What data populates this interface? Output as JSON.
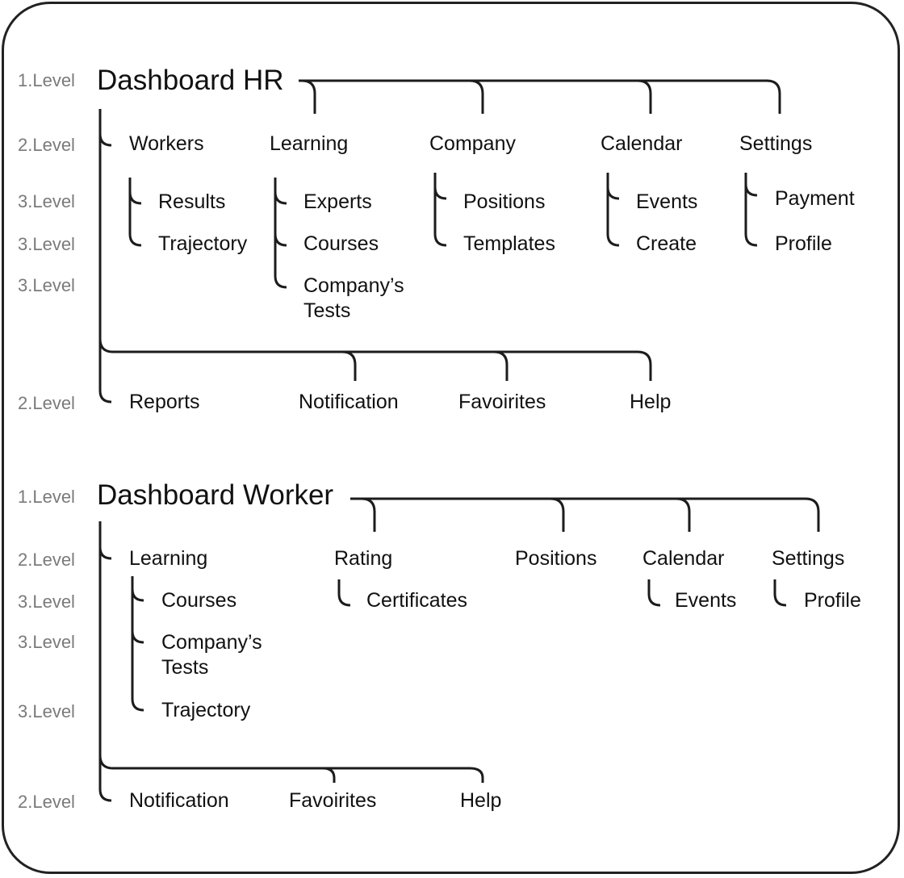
{
  "colors": {
    "line": "#1c1c1c",
    "text": "#111111",
    "level_label": "#7a7a7a",
    "frame": "#222222"
  },
  "hr": {
    "level_labels": [
      "1.Level",
      "2.Level",
      "3.Level",
      "3.Level",
      "3.Level",
      "2.Level"
    ],
    "title": "Dashboard HR",
    "sections": [
      {
        "label": "Workers",
        "children": [
          "Results",
          "Trajectory"
        ]
      },
      {
        "label": "Learning",
        "children": [
          "Experts",
          "Courses",
          "Company’s Tests"
        ]
      },
      {
        "label": "Company",
        "children": [
          "Positions",
          "Templates"
        ]
      },
      {
        "label": "Calendar",
        "children": [
          "Events",
          "Create"
        ]
      },
      {
        "label": "Settings",
        "children": [
          "Payment",
          "Profile"
        ]
      }
    ],
    "bottom_items": [
      "Reports",
      "Notification",
      "Favoirites",
      "Help"
    ]
  },
  "worker": {
    "level_labels": [
      "1.Level",
      "2.Level",
      "3.Level",
      "3.Level",
      "3.Level",
      "2.Level"
    ],
    "title": "Dashboard Worker",
    "sections": [
      {
        "label": "Learning",
        "children": [
          "Courses",
          "Company’s Tests",
          "Trajectory"
        ]
      },
      {
        "label": "Rating",
        "children": [
          "Certificates"
        ]
      },
      {
        "label": "Positions",
        "children": []
      },
      {
        "label": "Calendar",
        "children": [
          "Events"
        ]
      },
      {
        "label": "Settings",
        "children": [
          "Profile"
        ]
      }
    ],
    "bottom_items": [
      "Notification",
      "Favoirites",
      "Help"
    ]
  }
}
